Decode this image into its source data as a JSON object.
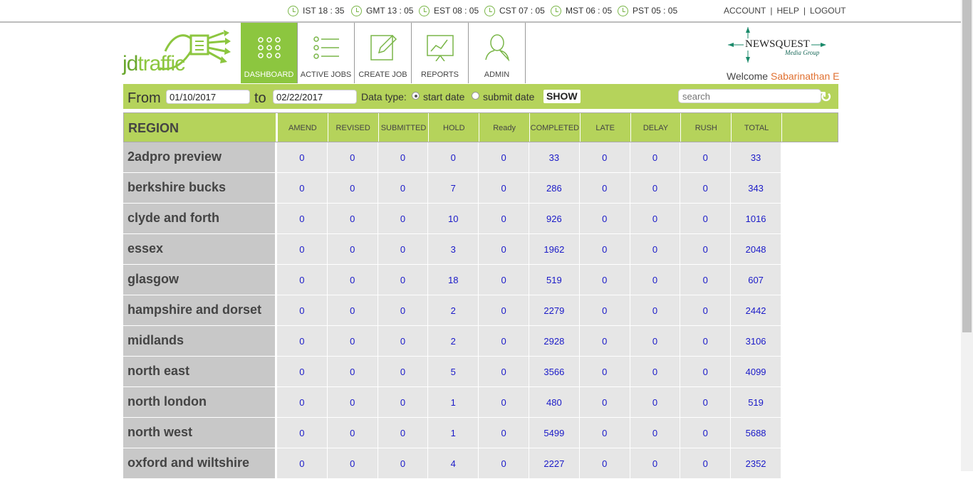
{
  "clocks": [
    {
      "label": "IST 18 : 35"
    },
    {
      "label": "GMT 13 : 05"
    },
    {
      "label": "EST 08 : 05"
    },
    {
      "label": "CST 07 : 05"
    },
    {
      "label": "MST 06 : 05"
    },
    {
      "label": "PST 05 : 05"
    }
  ],
  "toplinks": {
    "account": "ACCOUNT",
    "help": "HELP",
    "logout": "LOGOUT",
    "separator": "|"
  },
  "brand": {
    "logo_prefix": "jd",
    "logo_suffix": "traffic",
    "partner_main": "NEWSQUEST",
    "partner_sub": "Media Group",
    "accent": "#8cc63f"
  },
  "nav": [
    {
      "label": "DASHBOARD",
      "icon": "grid-icon",
      "active": true
    },
    {
      "label": "ACTIVE JOBS",
      "icon": "list-icon"
    },
    {
      "label": "CREATE JOB",
      "icon": "edit-icon"
    },
    {
      "label": "REPORTS",
      "icon": "chart-icon"
    },
    {
      "label": "ADMIN",
      "icon": "user-icon"
    }
  ],
  "welcome": {
    "text": "Welcome",
    "name": "Sabarinathan E"
  },
  "filter": {
    "from_label": "From",
    "from_value": "01/10/2017",
    "to_label": "to",
    "to_value": "02/22/2017",
    "datatype_label": "Data type:",
    "option_start": "start date",
    "option_submit": "submit date",
    "selected": "start date",
    "show_label": "SHOW",
    "search_placeholder": "search",
    "refresh_icon": "↻"
  },
  "table": {
    "region_header": "REGION",
    "columns": [
      "AMEND",
      "REVISED",
      "SUBMITTED",
      "HOLD",
      "Ready",
      "COMPLETED",
      "LATE",
      "DELAY",
      "RUSH",
      "TOTAL"
    ],
    "rows": [
      {
        "region": "2adpro preview",
        "values": [
          "0",
          "0",
          "0",
          "0",
          "0",
          "33",
          "0",
          "0",
          "0",
          "33"
        ]
      },
      {
        "region": "berkshire bucks",
        "values": [
          "0",
          "0",
          "0",
          "7",
          "0",
          "286",
          "0",
          "0",
          "0",
          "343"
        ]
      },
      {
        "region": "clyde and forth",
        "values": [
          "0",
          "0",
          "0",
          "10",
          "0",
          "926",
          "0",
          "0",
          "0",
          "1016"
        ]
      },
      {
        "region": "essex",
        "values": [
          "0",
          "0",
          "0",
          "3",
          "0",
          "1962",
          "0",
          "0",
          "0",
          "2048"
        ]
      },
      {
        "region": "glasgow",
        "values": [
          "0",
          "0",
          "0",
          "18",
          "0",
          "519",
          "0",
          "0",
          "0",
          "607"
        ]
      },
      {
        "region": "hampshire and dorset",
        "values": [
          "0",
          "0",
          "0",
          "2",
          "0",
          "2279",
          "0",
          "0",
          "0",
          "2442"
        ]
      },
      {
        "region": "midlands",
        "values": [
          "0",
          "0",
          "0",
          "2",
          "0",
          "2928",
          "0",
          "0",
          "0",
          "3106"
        ]
      },
      {
        "region": "north east",
        "values": [
          "0",
          "0",
          "0",
          "5",
          "0",
          "3566",
          "0",
          "0",
          "0",
          "4099"
        ]
      },
      {
        "region": "north london",
        "values": [
          "0",
          "0",
          "0",
          "1",
          "0",
          "480",
          "0",
          "0",
          "0",
          "519"
        ]
      },
      {
        "region": "north west",
        "values": [
          "0",
          "0",
          "0",
          "1",
          "0",
          "5499",
          "0",
          "0",
          "0",
          "5688"
        ]
      },
      {
        "region": "oxford and wiltshire",
        "values": [
          "0",
          "0",
          "0",
          "4",
          "0",
          "2227",
          "0",
          "0",
          "0",
          "2352"
        ]
      }
    ]
  }
}
